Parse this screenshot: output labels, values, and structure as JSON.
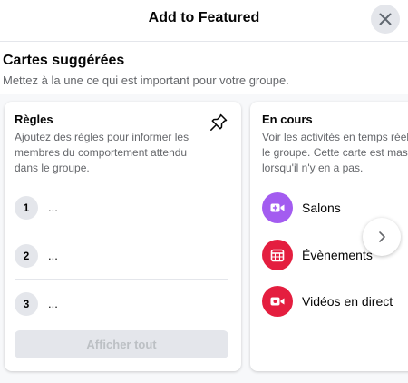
{
  "dialog": {
    "title": "Add to Featured",
    "close_icon": "close-icon"
  },
  "section": {
    "title": "Cartes suggérées",
    "subtitle": "Mettez à la une ce qui est important pour votre groupe."
  },
  "rules_card": {
    "title": "Règles",
    "description": "Ajoutez des règles pour informer les membres du comportement attendu dans le groupe.",
    "pin_icon": "pin-icon",
    "rules": [
      {
        "number": "1",
        "text": "..."
      },
      {
        "number": "2",
        "text": "..."
      },
      {
        "number": "3",
        "text": "..."
      }
    ],
    "show_all_label": "Afficher tout"
  },
  "current_card": {
    "title": "En cours",
    "description_lines": [
      "Voir les activités en temps réel dans",
      "le groupe. Cette carte est masquée",
      "lorsqu'il n'y en a pas."
    ],
    "activities": [
      {
        "label": "Salons",
        "icon": "video-camera-icon",
        "color": "#a35cf0"
      },
      {
        "label": "Évènements",
        "icon": "calendar-icon",
        "color": "#e41e3f"
      },
      {
        "label": "Vidéos en direct",
        "icon": "live-video-icon",
        "color": "#e41e3f"
      }
    ]
  },
  "next_button_icon": "chevron-right-icon",
  "colors": {
    "muted_text": "#65676b",
    "divider": "#e4e6eb",
    "rooms_purple": "#a35cf0",
    "live_red": "#e41e3f"
  }
}
